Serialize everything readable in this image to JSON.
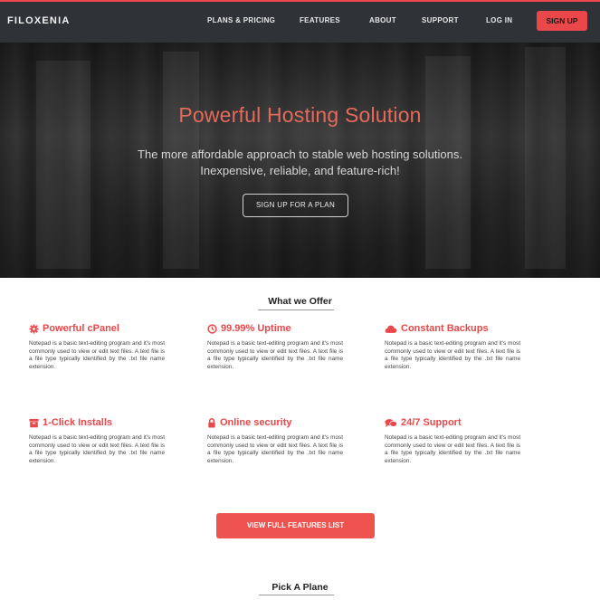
{
  "brand": {
    "name": "FILOXENIA",
    "accent": "#e9474a"
  },
  "nav": {
    "items": [
      "PLANS & PRICING",
      "FEATURES",
      "ABOUT",
      "SUPPORT",
      "LOG IN"
    ],
    "signup_label": "SIGN UP"
  },
  "hero": {
    "title": "Powerful Hosting Solution",
    "subtitle_line1": "The more affordable approach to stable web hosting solutions.",
    "subtitle_line2": "Inexpensive, reliable, and feature-rich!",
    "cta_label": "SIGN UP FOR A PLAN"
  },
  "offer": {
    "title": "What we Offer",
    "features": [
      {
        "icon": "gear-icon",
        "title": "Powerful cPanel",
        "body": "Notepad is a basic text-editing program and it's most commonly used to view or edit text files. A text file is a file type typically identified by the .txt file name extension."
      },
      {
        "icon": "clock-icon",
        "title": "99.99% Uptime",
        "body": "Notepad is a basic text-editing program and it's most commonly used to view or edit text files. A text file is a file type typically identified by the .txt file name extension."
      },
      {
        "icon": "cloud-icon",
        "title": "Constant Backups",
        "body": "Notepad is a basic text-editing program and it's most commonly used to view or edit text files. A text file is a file type typically identified by the .txt file name extension."
      },
      {
        "icon": "box-icon",
        "title": "1-Click Installs",
        "body": "Notepad is a basic text-editing program and it's most commonly used to view or edit text files. A text file is a file type typically identified by the .txt file name extension."
      },
      {
        "icon": "lock-icon",
        "title": "Online security",
        "body": "Notepad is a basic text-editing program and it's most commonly used to view or edit text files. A text file is a file type typically identified by the .txt file name extension."
      },
      {
        "icon": "chat-icon",
        "title": "24/7 Support",
        "body": "Notepad is a basic text-editing program and it's most commonly used to view or edit text files. A text file is a file type typically identified by the .txt file name extension."
      }
    ],
    "button_label": "VIEW FULL FEATURES LIST"
  },
  "plans": {
    "title": "Pick A Plane"
  }
}
